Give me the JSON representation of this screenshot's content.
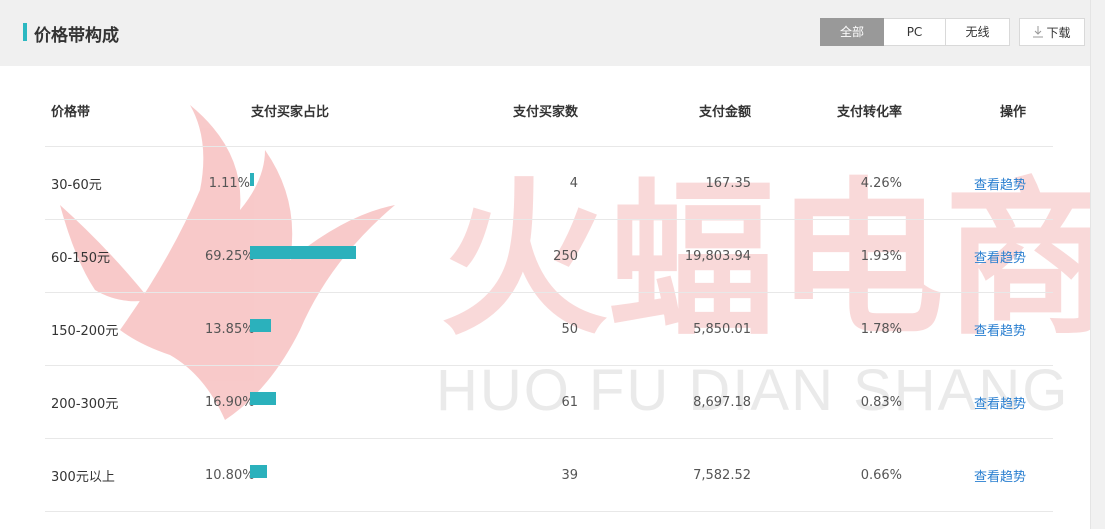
{
  "header": {
    "title": "价格带构成",
    "tabs": [
      {
        "label": "全部",
        "active": true
      },
      {
        "label": "PC",
        "active": false
      },
      {
        "label": "无线",
        "active": false
      }
    ],
    "download_label": "下载"
  },
  "table": {
    "columns": [
      "价格带",
      "支付买家占比",
      "支付买家数",
      "支付金额",
      "支付转化率",
      "操作"
    ],
    "rows": [
      {
        "band": "30-60元",
        "pct": "1.11%",
        "pct_value": 1.11,
        "buyers": "4",
        "amount": "167.35",
        "rate": "4.26%",
        "action": "查看趋势"
      },
      {
        "band": "60-150元",
        "pct": "69.25%",
        "pct_value": 69.25,
        "buyers": "250",
        "amount": "19,803.94",
        "rate": "1.93%",
        "action": "查看趋势"
      },
      {
        "band": "150-200元",
        "pct": "13.85%",
        "pct_value": 13.85,
        "buyers": "50",
        "amount": "5,850.01",
        "rate": "1.78%",
        "action": "查看趋势"
      },
      {
        "band": "200-300元",
        "pct": "16.90%",
        "pct_value": 16.9,
        "buyers": "61",
        "amount": "8,697.18",
        "rate": "0.83%",
        "action": "查看趋势"
      },
      {
        "band": "300元以上",
        "pct": "10.80%",
        "pct_value": 10.8,
        "buyers": "39",
        "amount": "7,582.52",
        "rate": "0.66%",
        "action": "查看趋势"
      }
    ]
  },
  "watermark": {
    "text_cn": "火蝠电商",
    "text_en": "HUO FU DIAN SHANG"
  },
  "colors": {
    "accent": "#2bb8c1",
    "bar": "#2bb1bc",
    "link": "#2a7fd0",
    "active_tab": "#999999",
    "watermark": "#f3b3b3"
  }
}
